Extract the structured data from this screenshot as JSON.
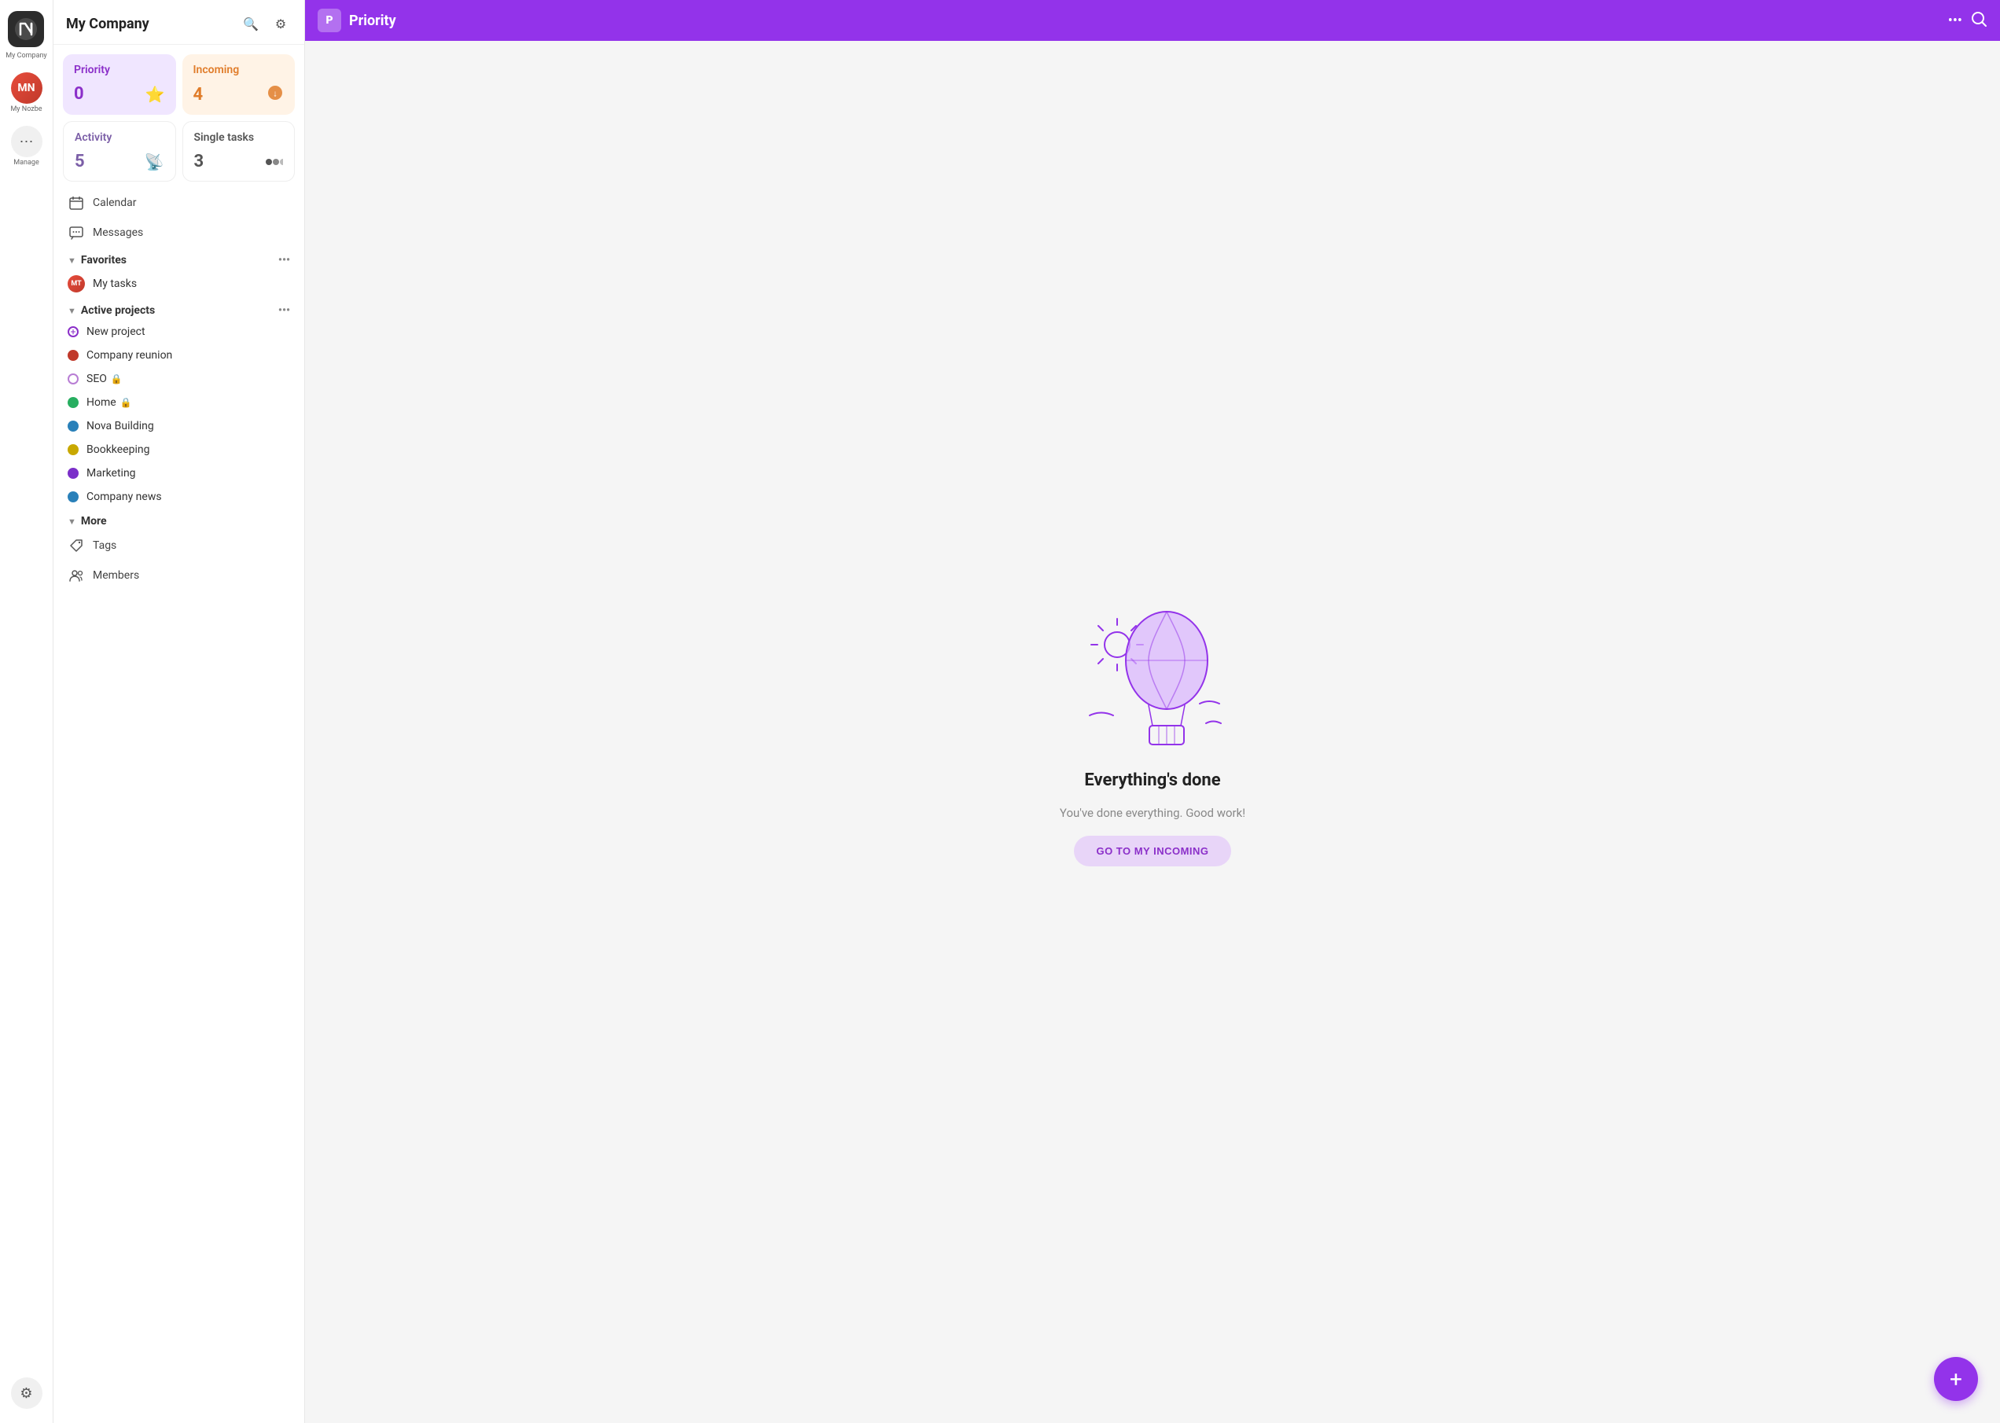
{
  "app": {
    "company_name": "My Company",
    "logo_letter": "N"
  },
  "icon_bar": {
    "company_label": "My Company",
    "my_nozbe_label": "My Nozbe",
    "manage_label": "Manage"
  },
  "sidebar": {
    "title": "My Company",
    "search_icon": "search",
    "settings_icon": "settings",
    "cards": [
      {
        "id": "priority",
        "label": "Priority",
        "count": "0",
        "icon": "⭐",
        "type": "priority"
      },
      {
        "id": "incoming",
        "label": "Incoming",
        "count": "4",
        "icon": "🟠",
        "type": "incoming"
      },
      {
        "id": "activity",
        "label": "Activity",
        "count": "5",
        "icon": "📡",
        "type": "activity"
      },
      {
        "id": "single-tasks",
        "label": "Single tasks",
        "count": "3",
        "icon": "⚫⚫",
        "type": "single"
      }
    ],
    "nav_items": [
      {
        "id": "calendar",
        "label": "Calendar",
        "icon": "📅"
      },
      {
        "id": "messages",
        "label": "Messages",
        "icon": "💬"
      }
    ],
    "favorites": {
      "label": "Favorites",
      "more_icon": "•••",
      "items": [
        {
          "id": "my-tasks",
          "label": "My tasks",
          "has_avatar": true
        }
      ]
    },
    "active_projects": {
      "label": "Active projects",
      "more_icon": "•••",
      "items": [
        {
          "id": "new-project",
          "label": "New project",
          "color": null,
          "is_add": true
        },
        {
          "id": "company-reunion",
          "label": "Company reunion",
          "color": "#c0392b"
        },
        {
          "id": "seo",
          "label": "SEO",
          "color": "#c084e8",
          "badge": "🔒"
        },
        {
          "id": "home",
          "label": "Home",
          "color": "#27ae60",
          "badge": "🔒"
        },
        {
          "id": "nova-building",
          "label": "Nova Building",
          "color": "#2980b9"
        },
        {
          "id": "bookkeeping",
          "label": "Bookkeeping",
          "color": "#c8a800"
        },
        {
          "id": "marketing",
          "label": "Marketing",
          "color": "#7b2fc9"
        },
        {
          "id": "company-news",
          "label": "Company news",
          "color": "#2980b9"
        }
      ]
    },
    "more": {
      "label": "More",
      "items": [
        {
          "id": "tags",
          "label": "Tags",
          "icon": "🏷️"
        },
        {
          "id": "members",
          "label": "Members",
          "icon": "👥"
        }
      ]
    }
  },
  "topbar": {
    "logo_letter": "P",
    "title": "Priority",
    "dots_icon": "•••",
    "search_icon": "🔍"
  },
  "main": {
    "empty_title": "Everything's done",
    "empty_subtitle": "You've done everything. Good work!",
    "goto_button_label": "GO TO MY INCOMING"
  },
  "fab": {
    "icon": "+"
  },
  "colors": {
    "priority_purple": "#9333ea",
    "priority_bg": "#f0e6ff",
    "incoming_orange": "#e07c2a",
    "incoming_bg": "#fff3e6",
    "activity_purple": "#7b5ea7",
    "topbar_purple": "#9333ea",
    "fab_purple": "#9333ea"
  }
}
